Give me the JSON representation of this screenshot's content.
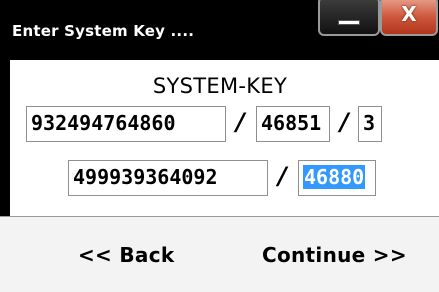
{
  "window": {
    "title": "Enter System Key ....",
    "close_glyph": "X"
  },
  "dialog": {
    "label": "SYSTEM-KEY",
    "row1": {
      "field1": "932494764860",
      "sep1": "/",
      "field2": "46851",
      "sep2": "/",
      "field3": "3"
    },
    "row2": {
      "field1": "499939364092",
      "sep": "/",
      "field2": "46880"
    }
  },
  "buttons": {
    "back": "<< Back",
    "continue": "Continue >>"
  },
  "colors": {
    "selection": "#3399ff",
    "titlebar": "#000000",
    "close": "#c84b30"
  }
}
